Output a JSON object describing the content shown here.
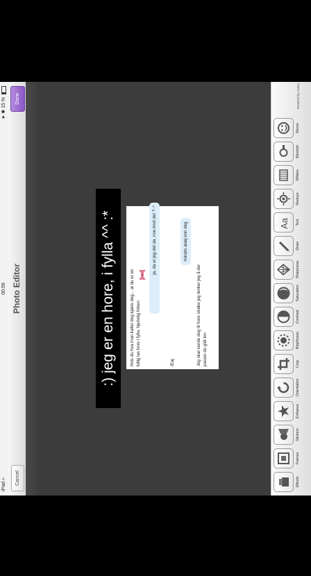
{
  "status_bar": {
    "carrier": "iPad",
    "wifi_icon": "wifi-icon",
    "time": "00:59",
    "battery_percent": "15 %",
    "bluetooth_icon": "bluetooth-icon",
    "location_icon": "location-arrow-icon"
  },
  "navbar": {
    "title": "Photo Editor",
    "cancel_label": "Cancel",
    "done_label": "Done",
    "done_color": "#8a55c4"
  },
  "photo": {
    "caption": ":) jeg er en hore, i fylla  ^^ :*",
    "messages": [
      {
        "text": "Hvis du hva man kaller deg kjære deg... at du er en billig las hore i fylla. hjertelig hilsen",
        "side": "in"
      },
      {
        "text": "ja, da er jeg det da. noe imot det ? :*",
        "side": "out"
      },
      {
        "text": "/Eaj",
        "side": "in"
      },
      {
        "text": "mindre ææj enn deg",
        "side": "out"
      },
      {
        "text": "Jeg skal sende deg til hore strøke jeg tenker jeg å der passer du gldt inn",
        "side": "in"
      }
    ]
  },
  "tools": [
    {
      "label": "Effects",
      "icon": "effects-icon"
    },
    {
      "label": "Frames",
      "icon": "frames-icon"
    },
    {
      "label": "Stickers",
      "icon": "stickers-icon"
    },
    {
      "label": "Enhance",
      "icon": "enhance-icon"
    },
    {
      "label": "Orientation",
      "icon": "orientation-icon"
    },
    {
      "label": "Crop",
      "icon": "crop-icon"
    },
    {
      "label": "Brightness",
      "icon": "brightness-icon"
    },
    {
      "label": "Contrast",
      "icon": "contrast-icon"
    },
    {
      "label": "Saturation",
      "icon": "saturation-icon"
    },
    {
      "label": "Sharpness",
      "icon": "sharpness-icon"
    },
    {
      "label": "Draw",
      "icon": "draw-icon"
    },
    {
      "label": "Text",
      "icon": "text-icon"
    },
    {
      "label": "Redeye",
      "icon": "redeye-icon"
    },
    {
      "label": "Whiten",
      "icon": "whiten-icon"
    },
    {
      "label": "Blemish",
      "icon": "blemish-icon"
    },
    {
      "label": "Meme",
      "icon": "meme-icon"
    }
  ],
  "brand_text": "Powered by Aviary",
  "page_indicator": {
    "pages": 2,
    "current": 1
  }
}
